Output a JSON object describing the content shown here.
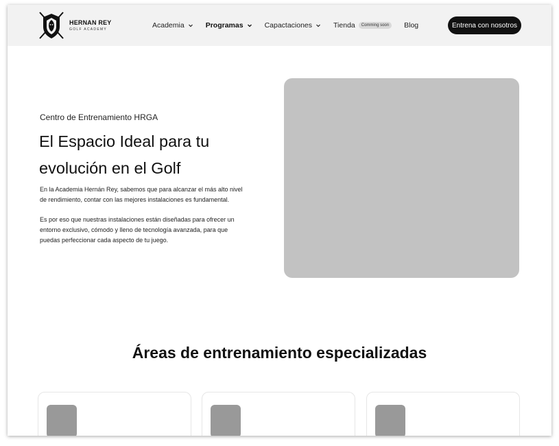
{
  "brand": {
    "name": "HERNAN REY",
    "tagline": "GOLF ACADEMY",
    "logo_icon": "lion-crest-crossed-clubs-icon"
  },
  "nav": {
    "items": [
      {
        "label": "Academia",
        "dropdown": true
      },
      {
        "label": "Programas",
        "dropdown": true,
        "active": true
      },
      {
        "label": "Capactaciones",
        "dropdown": true
      },
      {
        "label": "Tienda",
        "badge": "Comming soon"
      },
      {
        "label": "Blog"
      }
    ]
  },
  "cta": {
    "label": "Entrena con nosotros"
  },
  "hero": {
    "eyebrow": "Centro de Entrenamiento HRGA",
    "title": "El Espacio Ideal para tu evolución en el Golf",
    "paragraph_1": "En la Academia Hernán Rey, sabemos que para alcanzar el más alto nivel de rendimiento, contar con las mejores instalaciones es fundamental.",
    "paragraph_2": "Es por eso que nuestras instalaciones están diseñadas para ofrecer un entorno exclusivo, cómodo y lleno de tecnología avanzada, para que puedas perfeccionar cada aspecto de tu juego."
  },
  "section": {
    "title": "Áreas de entrenamiento especializadas"
  },
  "colors": {
    "header_bg": "#f2f2f2",
    "cta_bg": "#111111",
    "placeholder": "#c2c2c2",
    "thumb": "#999999"
  }
}
